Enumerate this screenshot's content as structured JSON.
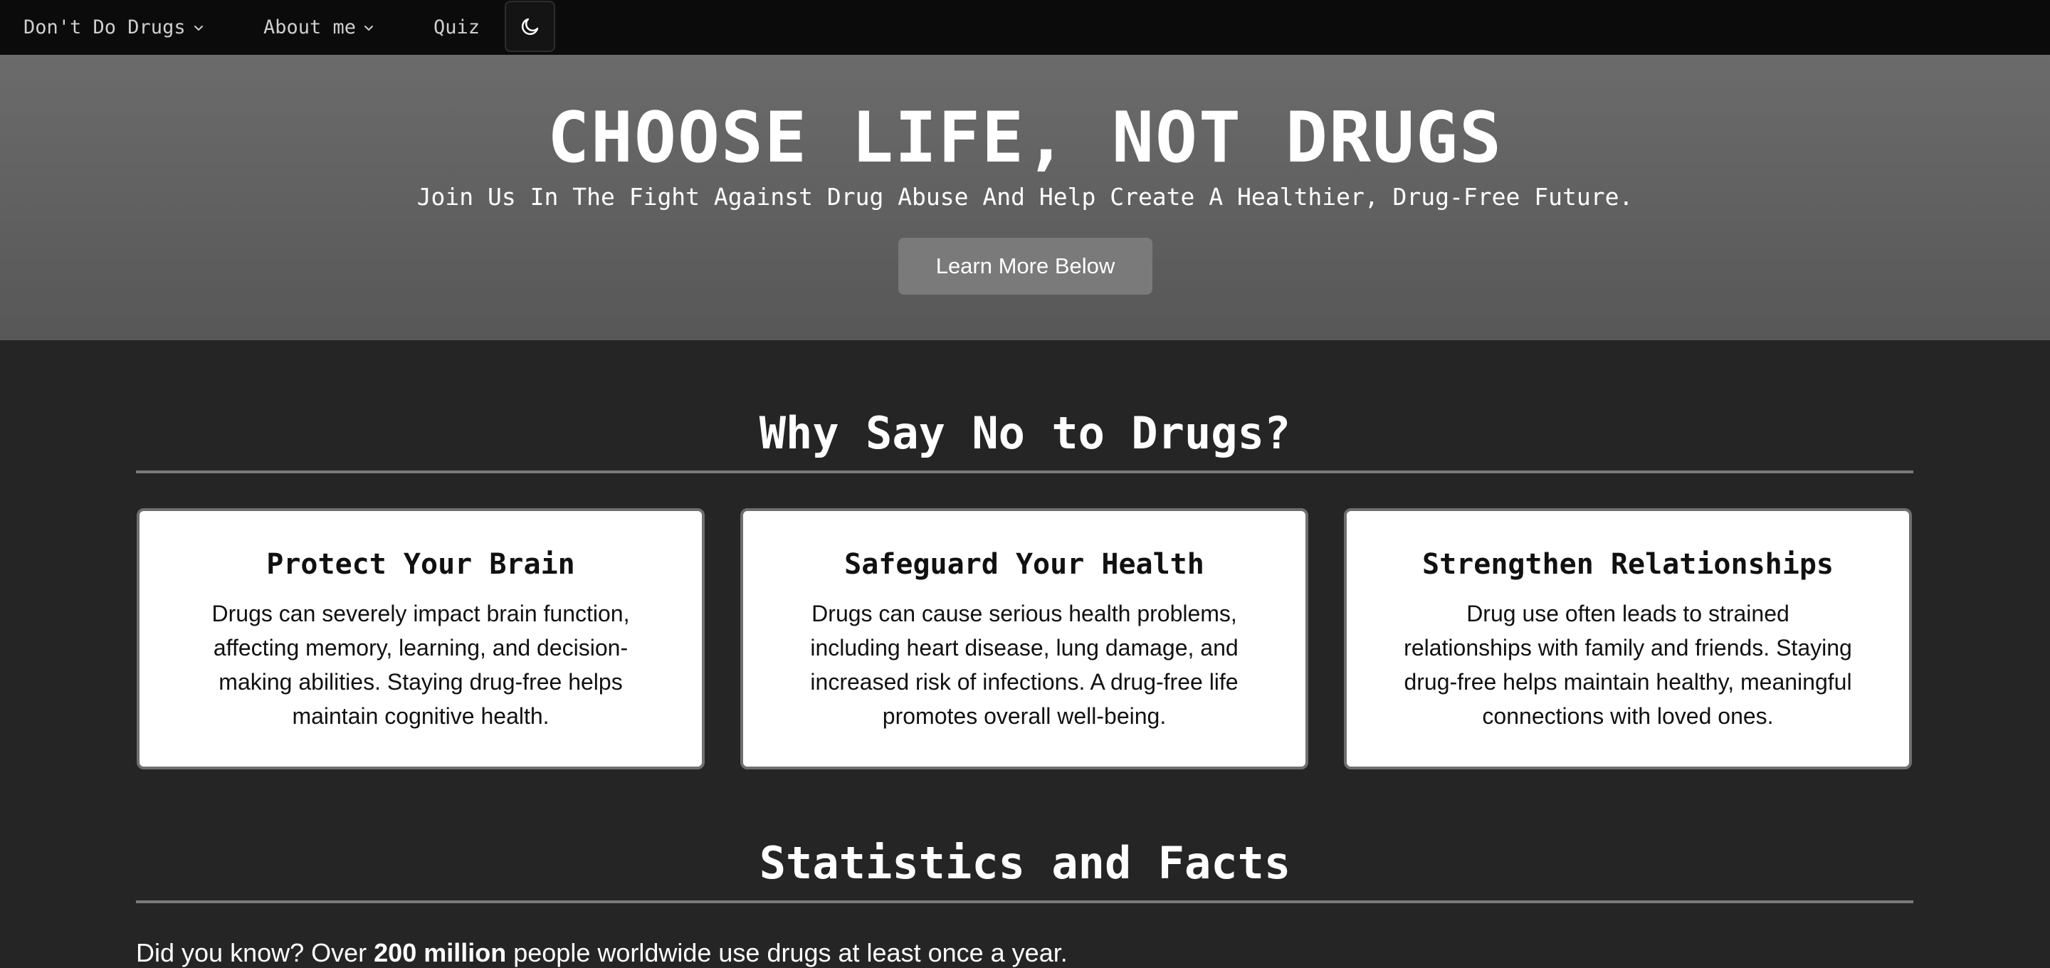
{
  "nav": {
    "brand_label": "Don't Do Drugs",
    "about_label": "About me",
    "quiz_label": "Quiz",
    "theme_icon": "moon-icon"
  },
  "hero": {
    "title": "CHOOSE LIFE, NOT DRUGS",
    "subtitle": "Join Us In The Fight Against Drug Abuse And Help Create A Healthier, Drug-Free Future.",
    "button_label": "Learn More Below"
  },
  "why": {
    "title": "Why Say No to Drugs?",
    "cards": [
      {
        "title": "Protect Your Brain",
        "text": "Drugs can severely impact brain function, affecting memory, learning, and decision-making abilities. Staying drug-free helps maintain cognitive health."
      },
      {
        "title": "Safeguard Your Health",
        "text": "Drugs can cause serious health problems, including heart disease, lung damage, and increased risk of infections. A drug-free life promotes overall well-being."
      },
      {
        "title": "Strengthen Relationships",
        "text": "Drug use often leads to strained relationships with family and friends. Staying drug-free helps maintain healthy, meaningful connections with loved ones."
      }
    ]
  },
  "stats": {
    "title": "Statistics and Facts",
    "fact_prefix": "Did you know? Over ",
    "fact_highlight": "200 million",
    "fact_suffix": " people worldwide use drugs at least once a year."
  },
  "colors": {
    "nav_bg": "#0b0b0b",
    "hero_bg": "#5f5f5f",
    "page_bg": "#252525",
    "button_bg": "#7a7a7a",
    "card_bg": "#ffffff"
  }
}
